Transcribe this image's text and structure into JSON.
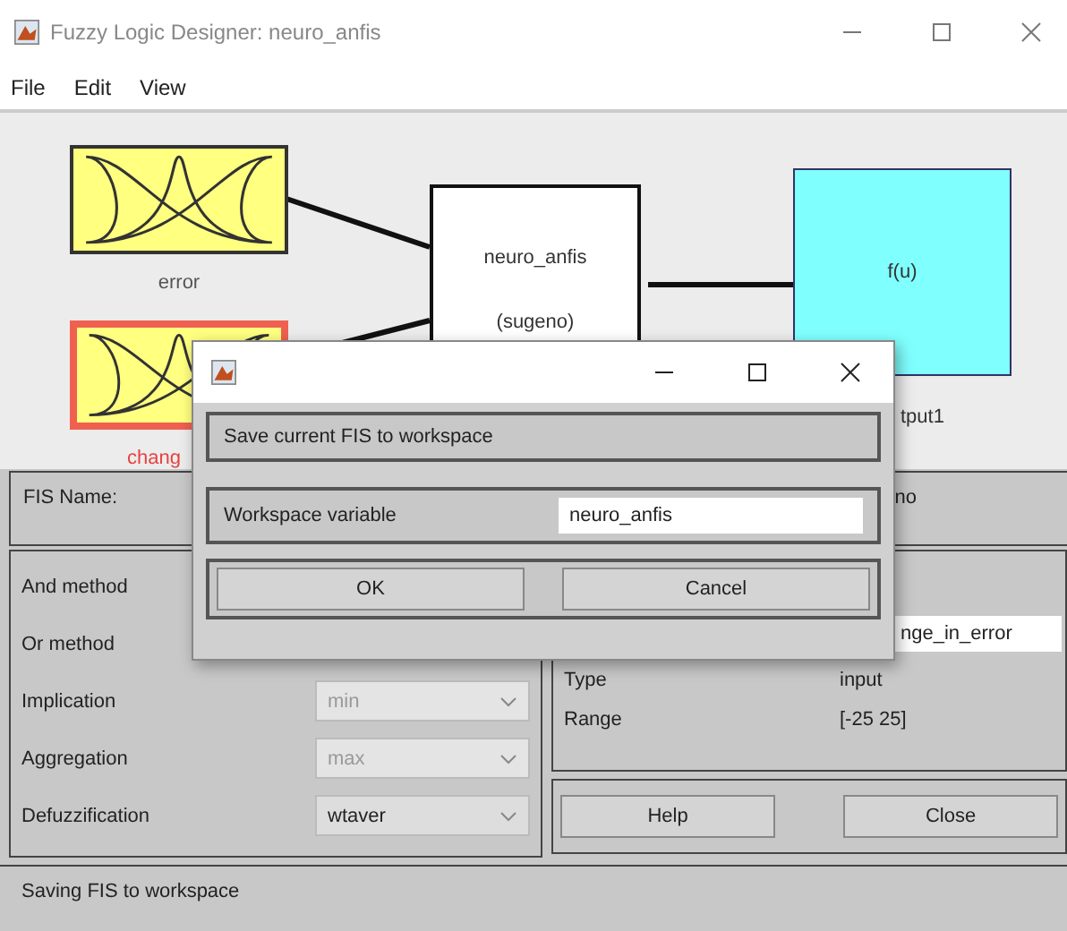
{
  "window": {
    "title": "Fuzzy Logic Designer: neuro_anfis"
  },
  "menu": [
    "File",
    "Edit",
    "View"
  ],
  "diagram": {
    "inputs": [
      {
        "label": "error",
        "selected": false
      },
      {
        "label": "chang",
        "selected": true
      }
    ],
    "system": {
      "name": "neuro_anfis",
      "type": "(sugeno)"
    },
    "output": {
      "formula": "f(u)",
      "label": "tput1"
    }
  },
  "fis": {
    "name_label": "FIS Name:",
    "type_value": "no"
  },
  "methods": [
    {
      "label": "And method"
    },
    {
      "label": "Or method"
    },
    {
      "label": "Implication",
      "value": "min",
      "disabled": true
    },
    {
      "label": "Aggregation",
      "value": "max",
      "disabled": true
    },
    {
      "label": "Defuzzification",
      "value": "wtaver",
      "disabled": false
    }
  ],
  "variable": {
    "name": "nge_in_error",
    "type_label": "Type",
    "type_value": "input",
    "range_label": "Range",
    "range_value": "[-25 25]"
  },
  "buttons": [
    "Help",
    "Close"
  ],
  "status_bar": "Saving FIS to workspace",
  "dialog": {
    "message": "Save current FIS to workspace",
    "field_label": "Workspace variable",
    "field_value": "neuro_anfis",
    "buttons": [
      "OK",
      "Cancel"
    ]
  }
}
